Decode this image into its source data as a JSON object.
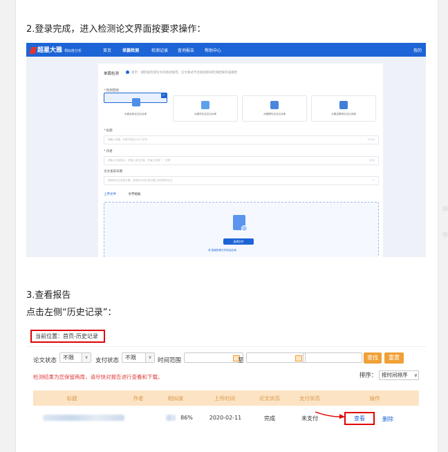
{
  "step2_heading": "2.登录完成，进入检测论文界面按要求操作：",
  "step3_heading": "3.查看报告",
  "step3_instruction": "点击左侧“历史记录”：",
  "screenshot1": {
    "logo": "超星大雅",
    "logo_sub": "相似度分析",
    "nav": [
      "首页",
      "单篇检测",
      "检测记录",
      "查询报告",
      "帮助中心"
    ],
    "user": "我的",
    "panel_title": "单篇检测",
    "panel_note": "提示：请检查检测论文的格式规范，论文格式不合规会影响检测结果的准确性",
    "section_range": "* 检测范围",
    "types": [
      "大雅全库论文比对库",
      "大雅学位论文比对库",
      "大雅期刊论文比对库",
      "大雅互联网论文比对库"
    ],
    "label_title": "* 标题",
    "title_placeholder": "请输入标题，字数不超过100个字符",
    "title_count": "0/100",
    "label_author": "* 作者",
    "author_placeholder": "请输入作者姓名，可输入多位作者，作者之间用“；”分隔",
    "author_count": "0/50",
    "label_date": "论文发表日期",
    "date_placeholder": "请选择论文发表日期，选择后只对比该日期之前发表的论文",
    "tab_upload": "上传文件",
    "tab_paste": "文字粘贴",
    "upload_button": "选择文件",
    "upload_hint": "或 直接拖拽文件到此区域"
  },
  "screenshot2": {
    "breadcrumb": "当前位置：首页-历史记录",
    "paper_status_label": "论文状态",
    "paper_status_value": "不限",
    "pay_status_label": "支付状态",
    "pay_status_value": "不限",
    "time_range_label": "时间范围",
    "to_label": "至",
    "query_button": "查找",
    "reset_button": "重置",
    "warning": "检测结果为您保留两周，请尽快对报告进行查看和下载。",
    "sort_label": "排序：",
    "sort_value": "按时间排序",
    "columns": [
      "标题",
      "作者",
      "相似度",
      "上传时间",
      "论文状态",
      "支付状态",
      "操作"
    ],
    "row": {
      "similarity": "86%",
      "upload_time": "2020-02-11",
      "paper_status": "完成",
      "pay_status": "未支付",
      "view": "查看",
      "delete": "删除"
    }
  },
  "colors": {
    "nav_blue": "#1d64d6",
    "highlight_red": "#e00000",
    "orange": "#f0a035",
    "table_header": "#fce3c4"
  }
}
